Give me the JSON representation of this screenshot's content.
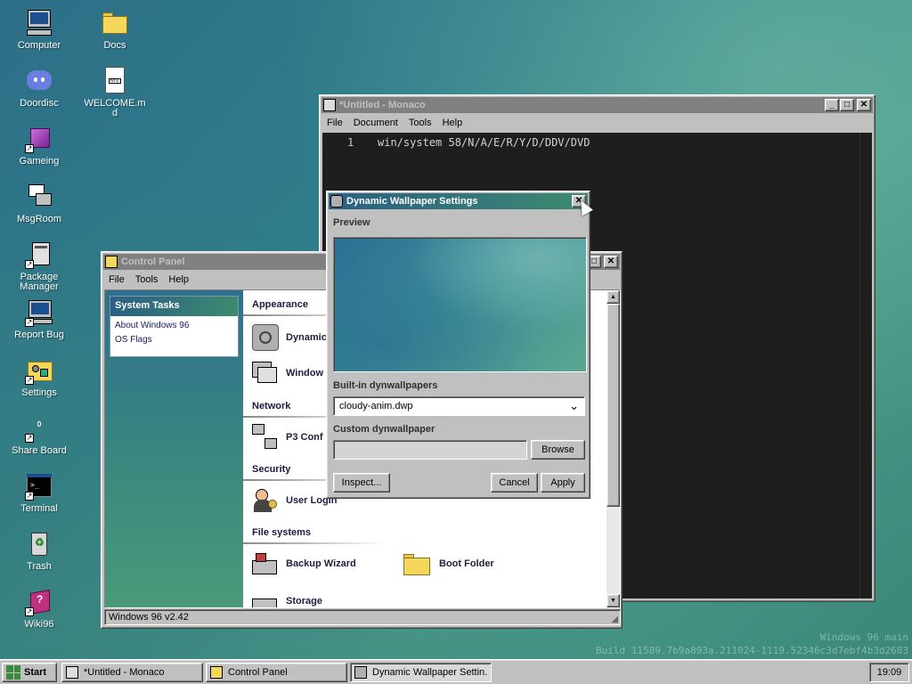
{
  "desktop": {
    "icons": [
      {
        "label": "Computer",
        "icon": "computer-icon"
      },
      {
        "label": "Docs",
        "icon": "folder-icon"
      },
      {
        "label": "Doordisc",
        "icon": "discord-icon"
      },
      {
        "label": "WELCOME.md",
        "icon": "markdown-file-icon"
      },
      {
        "label": "Gameing",
        "icon": "game-cube-icon"
      },
      {
        "label": "MsgRoom",
        "icon": "chat-icon"
      },
      {
        "label": "Package Manager",
        "icon": "package-icon"
      },
      {
        "label": "Report Bug",
        "icon": "bug-report-icon"
      },
      {
        "label": "Settings",
        "icon": "settings-icon"
      },
      {
        "label": "Share Board",
        "icon": "share-board-icon"
      },
      {
        "label": "Terminal",
        "icon": "terminal-icon"
      },
      {
        "label": "Trash",
        "icon": "recycle-bin-icon"
      },
      {
        "label": "Wiki96",
        "icon": "wiki-book-icon"
      }
    ],
    "watermark": {
      "line1": "Windows 96 main",
      "line2": "Build 11589.7b9a893a.211024-1119.52346c3d7ebf4b3d2683"
    }
  },
  "editor": {
    "title": "*Untitled - Monaco",
    "menu": [
      "File",
      "Document",
      "Tools",
      "Help"
    ],
    "line_number": "1",
    "code": "win/system 58/N/A/E/R/Y/D/DDV/DVD"
  },
  "control_panel": {
    "title": "Control Panel",
    "menu": [
      "File",
      "Tools",
      "Help"
    ],
    "tasks_header": "System Tasks",
    "tasks": [
      "About Windows 96",
      "OS Flags"
    ],
    "sections": {
      "appearance": "Appearance",
      "network": "Network",
      "security": "Security",
      "filesystems": "File systems"
    },
    "items": {
      "dynamic": "Dynamic",
      "window": "Window",
      "p3": "P3 Conf",
      "user_login": "User Login",
      "backup": "Backup Wizard",
      "boot_folder": "Boot Folder",
      "storage": "Storage"
    },
    "status": "Windows 96 v2.42"
  },
  "dialog": {
    "title": "Dynamic Wallpaper Settings",
    "preview_label": "Preview",
    "builtin_label": "Built-in dynwallpapers",
    "builtin_selected": "cloudy-anim.dwp",
    "custom_label": "Custom dynwallpaper",
    "custom_value": "",
    "browse": "Browse",
    "inspect": "Inspect...",
    "cancel": "Cancel",
    "apply": "Apply"
  },
  "taskbar": {
    "start": "Start",
    "tasks": [
      "*Untitled - Monaco",
      "Control Panel",
      "Dynamic Wallpaper Settin..."
    ],
    "clock": "19:09"
  }
}
